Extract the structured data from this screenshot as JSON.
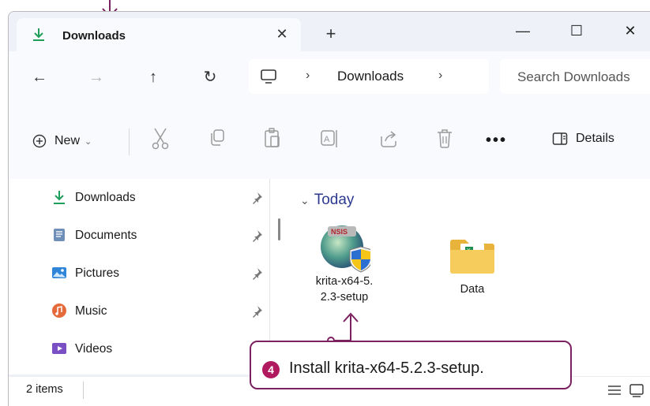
{
  "tab": {
    "title": "Downloads",
    "close_glyph": "✕",
    "new_tab_glyph": "+"
  },
  "window_controls": {
    "minimize": "—",
    "maximize": "☐",
    "close": "✕"
  },
  "nav": {
    "back": "←",
    "forward": "→",
    "up": "↑",
    "refresh": "↻",
    "breadcrumb_sep": "›",
    "breadcrumb": "Downloads",
    "search_placeholder": "Search Downloads"
  },
  "commandbar": {
    "new_label": "New",
    "new_caret": "⌄",
    "more": "•••",
    "details_label": "Details"
  },
  "sidebar": {
    "items": [
      {
        "label": "Downloads",
        "icon": "download-icon"
      },
      {
        "label": "Documents",
        "icon": "documents-icon"
      },
      {
        "label": "Pictures",
        "icon": "pictures-icon"
      },
      {
        "label": "Music",
        "icon": "music-icon"
      },
      {
        "label": "Videos",
        "icon": "videos-icon"
      }
    ]
  },
  "content": {
    "group_chevron": "⌄",
    "group": "Today",
    "files": [
      {
        "label_line1": "krita-x64-5.",
        "label_line2": "2.3-setup",
        "icon": "nsis-installer-icon"
      },
      {
        "label_line1": "Data",
        "label_line2": "",
        "icon": "folder-icon"
      }
    ]
  },
  "status": {
    "count": "2 items"
  },
  "annotation": {
    "step": "4",
    "text": "Install krita-x64-5.2.3-setup."
  },
  "colors": {
    "accent": "#b1195e",
    "callout_border": "#7b2160",
    "download_green": "#1e9e5a"
  }
}
